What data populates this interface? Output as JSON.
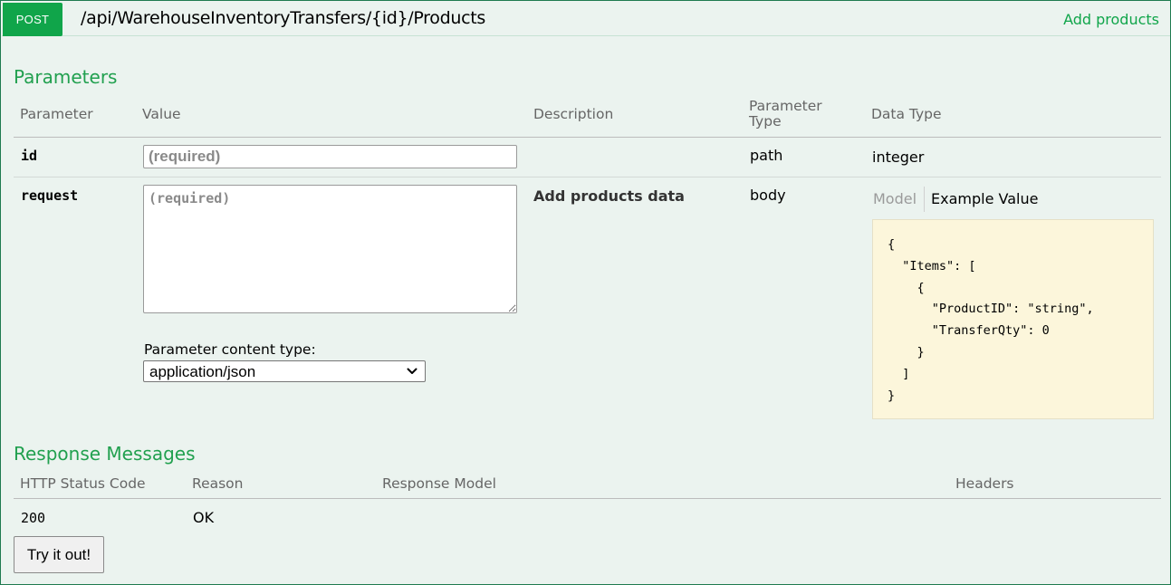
{
  "operation": {
    "method": "POST",
    "path": "/api/WarehouseInventoryTransfers/{id}/Products",
    "summary": "Add products"
  },
  "parameters": {
    "title": "Parameters",
    "headers": {
      "parameter": "Parameter",
      "value": "Value",
      "description": "Description",
      "param_type_line1": "Parameter",
      "param_type_line2": "Type",
      "data_type": "Data Type"
    },
    "rows": [
      {
        "name": "id",
        "placeholder": "(required)",
        "description": "",
        "param_type": "path",
        "data_type": "integer"
      },
      {
        "name": "request",
        "placeholder": "(required)",
        "description": "Add products data",
        "param_type": "body",
        "content_type_label": "Parameter content type:",
        "content_type_value": "application/json",
        "model_tab": "Model",
        "example_tab": "Example Value",
        "example_value": "{\n  \"Items\": [\n    {\n      \"ProductID\": \"string\",\n      \"TransferQty\": 0\n    }\n  ]\n}"
      }
    ]
  },
  "responses": {
    "title": "Response Messages",
    "headers": {
      "status": "HTTP Status Code",
      "reason": "Reason",
      "model": "Response Model",
      "headers": "Headers"
    },
    "rows": [
      {
        "status": "200",
        "reason": "OK"
      }
    ]
  },
  "try_button": "Try it out!",
  "colors": {
    "method_badge": "#10a54a",
    "accent": "#21a04f",
    "panel_bg": "#ebf3ef",
    "example_bg": "#fcf6db"
  }
}
